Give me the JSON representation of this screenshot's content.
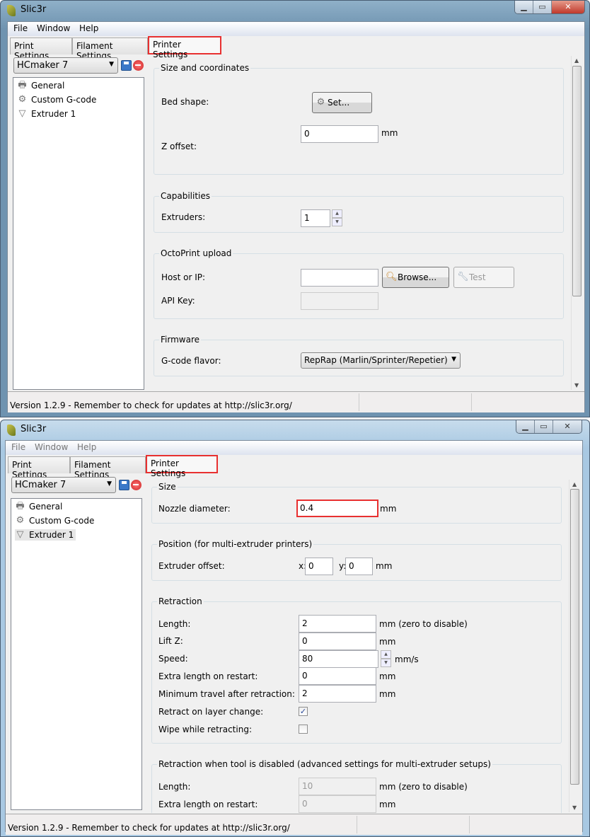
{
  "windows": [
    {
      "title": "Slic3r",
      "menu": [
        "File",
        "Window",
        "Help"
      ],
      "tabs": [
        "Print Settings",
        "Filament Settings",
        "Printer Settings"
      ],
      "active_tab": "Printer Settings",
      "preset": "HCmaker 7",
      "tree": [
        "General",
        "Custom G-code",
        "Extruder 1"
      ],
      "selected_tree_item": "General",
      "groups": {
        "size": {
          "title": "Size and coordinates",
          "bed_shape_label": "Bed shape:",
          "set_button": "Set...",
          "z_offset_label": "Z offset:",
          "z_offset_value": "0",
          "z_offset_unit": "mm"
        },
        "capabilities": {
          "title": "Capabilities",
          "extruders_label": "Extruders:",
          "extruders_value": "1"
        },
        "octoprint": {
          "title": "OctoPrint upload",
          "host_label": "Host or IP:",
          "host_value": "",
          "browse_button": "Browse...",
          "test_button": "Test",
          "api_key_label": "API Key:",
          "api_key_value": ""
        },
        "firmware": {
          "title": "Firmware",
          "flavor_label": "G-code flavor:",
          "flavor_value": "RepRap (Marlin/Sprinter/Repetier)"
        }
      },
      "status": "Version 1.2.9 - Remember to check for updates at http://slic3r.org/"
    },
    {
      "title": "Slic3r",
      "menu": [
        "File",
        "Window",
        "Help"
      ],
      "tabs": [
        "Print Settings",
        "Filament Settings",
        "Printer Settings"
      ],
      "active_tab": "Printer Settings",
      "preset": "HCmaker 7",
      "tree": [
        "General",
        "Custom G-code",
        "Extruder 1"
      ],
      "selected_tree_item": "Extruder 1",
      "groups": {
        "size": {
          "title": "Size",
          "nozzle_label": "Nozzle diameter:",
          "nozzle_value": "0.4",
          "nozzle_unit": "mm"
        },
        "position": {
          "title": "Position (for multi-extruder printers)",
          "offset_label": "Extruder offset:",
          "x_label": "x:",
          "x_value": "0",
          "y_label": "y:",
          "y_value": "0",
          "unit": "mm"
        },
        "retraction": {
          "title": "Retraction",
          "rows": [
            {
              "label": "Length:",
              "value": "2",
              "unit": "mm (zero to disable)"
            },
            {
              "label": "Lift Z:",
              "value": "0",
              "unit": "mm"
            },
            {
              "label": "Speed:",
              "value": "80",
              "unit": "mm/s"
            },
            {
              "label": "Extra length on restart:",
              "value": "0",
              "unit": "mm"
            },
            {
              "label": "Minimum travel after retraction:",
              "value": "2",
              "unit": "mm"
            }
          ],
          "retract_layer_change_label": "Retract on layer change:",
          "retract_layer_change": true,
          "wipe_label": "Wipe while retracting:",
          "wipe": false
        },
        "retraction_disabled": {
          "title": "Retraction when tool is disabled (advanced settings for multi-extruder setups)",
          "rows": [
            {
              "label": "Length:",
              "value": "10",
              "unit": "mm (zero to disable)"
            },
            {
              "label": "Extra length on restart:",
              "value": "0",
              "unit": "mm"
            }
          ]
        }
      },
      "status": "Version 1.2.9 - Remember to check for updates at http://slic3r.org/"
    }
  ]
}
